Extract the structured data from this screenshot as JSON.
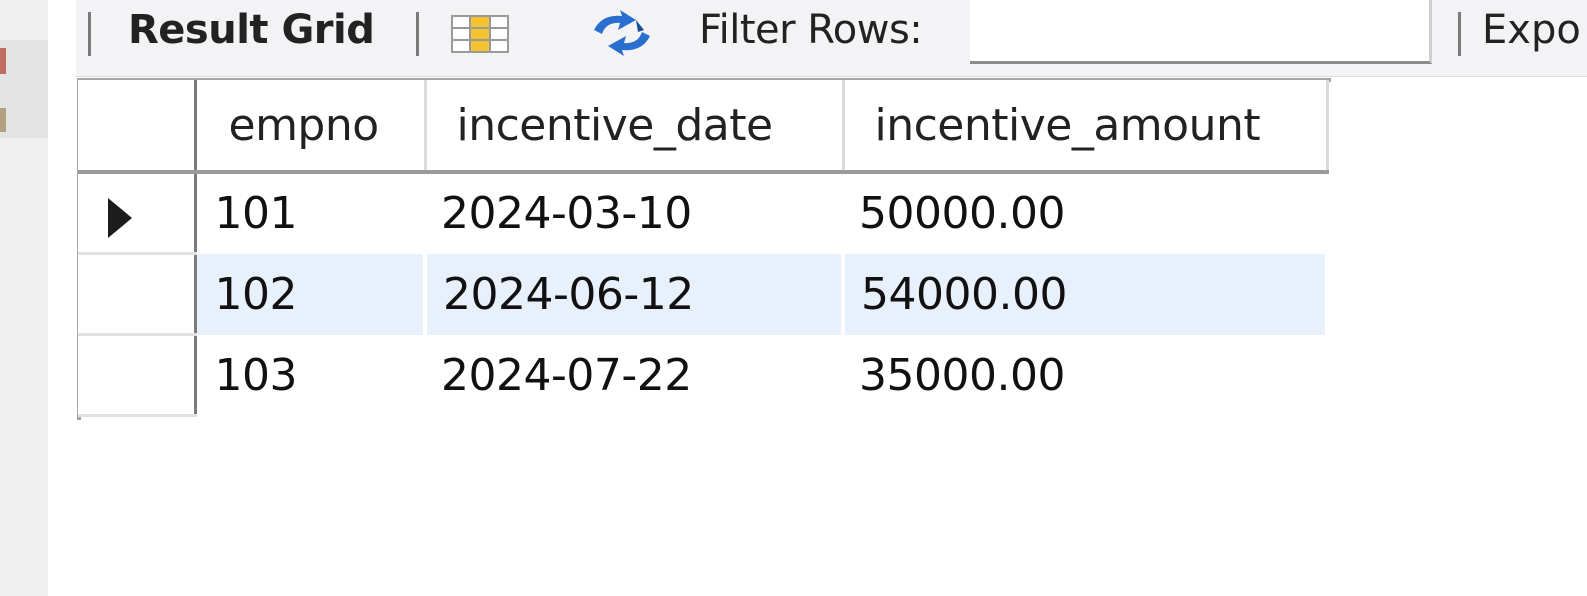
{
  "toolbar": {
    "result_grid_label": "Result Grid",
    "filter_label": "Filter Rows:",
    "filter_value": "",
    "export_label": "Expo",
    "icons": {
      "grid_icon": "grid-layout-icon",
      "refresh_icon": "refresh-icon"
    }
  },
  "grid": {
    "columns": [
      "empno",
      "incentive_date",
      "incentive_amount"
    ],
    "rows": [
      {
        "empno": "101",
        "incentive_date": "2024-03-10",
        "incentive_amount": "50000.00",
        "selected": true
      },
      {
        "empno": "102",
        "incentive_date": "2024-06-12",
        "incentive_amount": "54000.00",
        "selected": false
      },
      {
        "empno": "103",
        "incentive_date": "2024-07-22",
        "incentive_amount": "35000.00",
        "selected": false
      }
    ]
  },
  "colors": {
    "toolbar_bg": "#f3f3f5",
    "alt_row_bg": "#e8f0fb",
    "sidebar_bg": "#f0f0f0",
    "icon_yellow": "#f4c430",
    "icon_blue": "#2a6fd0"
  }
}
